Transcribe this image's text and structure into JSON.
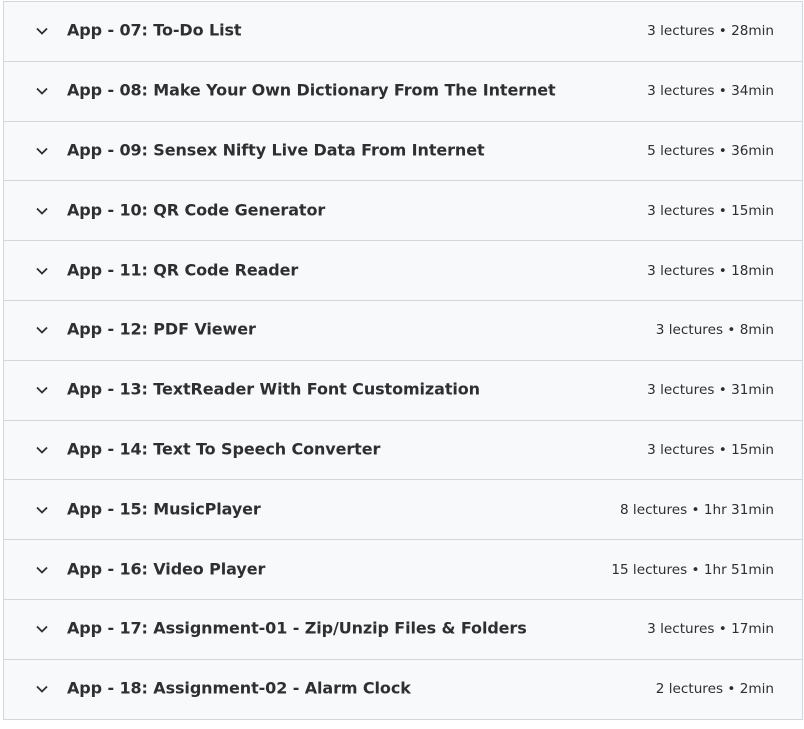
{
  "sections": [
    {
      "title": "App - 07: To-Do List",
      "meta": "3 lectures • 28min"
    },
    {
      "title": "App - 08: Make Your Own Dictionary From The Internet",
      "meta": "3 lectures • 34min"
    },
    {
      "title": "App - 09: Sensex Nifty Live Data From Internet",
      "meta": "5 lectures • 36min"
    },
    {
      "title": "App - 10: QR Code Generator",
      "meta": "3 lectures • 15min"
    },
    {
      "title": "App - 11: QR Code Reader",
      "meta": "3 lectures • 18min"
    },
    {
      "title": "App - 12: PDF Viewer",
      "meta": "3 lectures • 8min"
    },
    {
      "title": "App - 13: TextReader With Font Customization",
      "meta": "3 lectures • 31min"
    },
    {
      "title": "App - 14: Text To Speech Converter",
      "meta": "3 lectures • 15min"
    },
    {
      "title": "App - 15: MusicPlayer",
      "meta": "8 lectures • 1hr 31min"
    },
    {
      "title": "App - 16: Video Player",
      "meta": "15 lectures • 1hr 51min"
    },
    {
      "title": "App - 17: Assignment-01 - Zip/Unzip Files & Folders",
      "meta": "3 lectures • 17min"
    },
    {
      "title": "App - 18: Assignment-02 - Alarm Clock",
      "meta": "2 lectures • 2min"
    }
  ],
  "icons": {
    "expand": "chevron-down-icon"
  },
  "colors": {
    "row_background": "#f7f9fa",
    "border": "#d1d7dc",
    "text": "#2d2f31"
  }
}
